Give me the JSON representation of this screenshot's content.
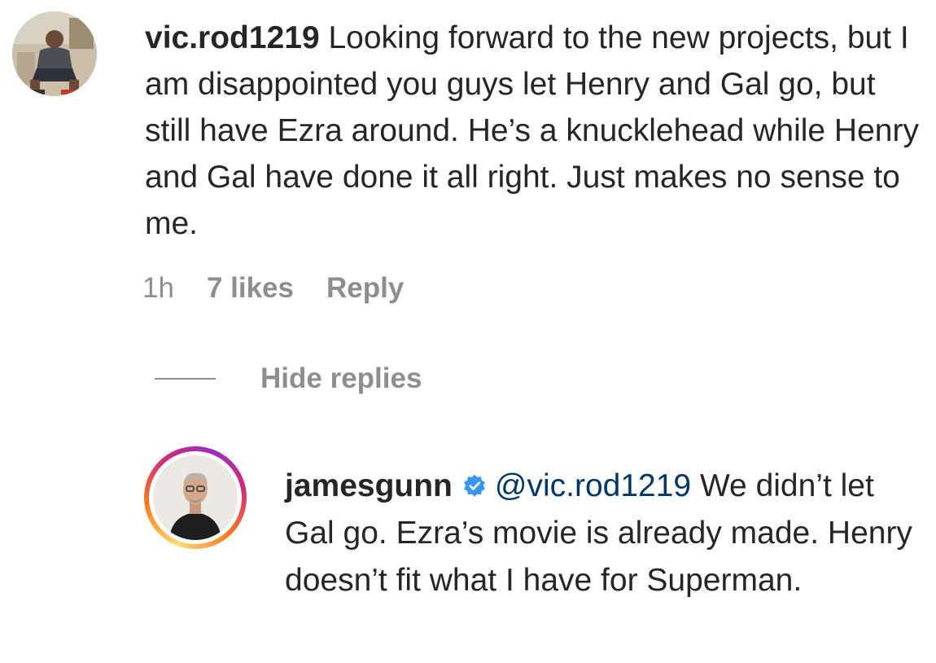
{
  "comment": {
    "username": "vic.rod1219",
    "text": "Looking forward to the new projects, but I am disappointed you guys let Henry and Gal go, but still have Ezra around. He’s a knucklehead while Henry and Gal have done it all right. Just makes no sense to me.",
    "time": "1h",
    "likes": "7 likes",
    "reply_label": "Reply"
  },
  "replies_toggle": {
    "label": "Hide replies"
  },
  "reply": {
    "username": "jamesgunn",
    "verified": true,
    "mention": "@vic.rod1219",
    "text": "We didn’t let Gal go. Ezra’s movie is already made. Henry doesn’t fit what I have for Superman."
  },
  "colors": {
    "text": "#262626",
    "secondary": "#8e8e8e",
    "mention": "#00376b",
    "verified": "#3797f0"
  }
}
